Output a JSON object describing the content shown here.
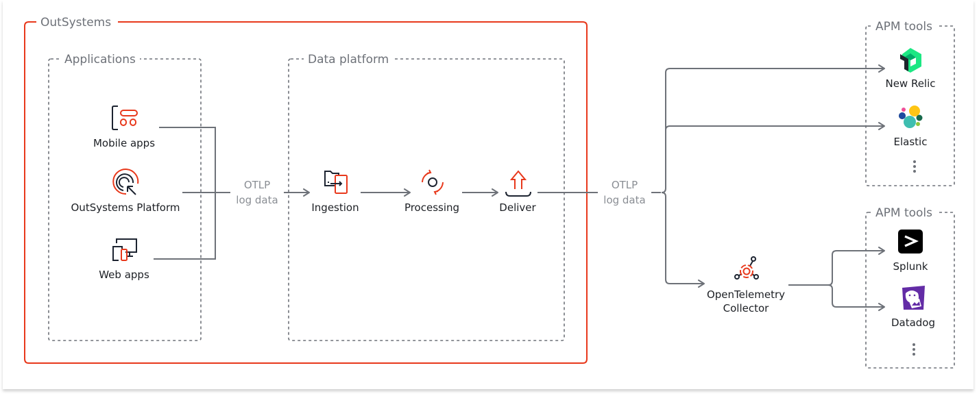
{
  "colors": {
    "brand_red": "#e8381b",
    "line_gray": "#6d7178",
    "dark": "#1c2330",
    "label_gray": "#8a8e94"
  },
  "groups": {
    "outsystems": {
      "title": "OutSystems"
    },
    "applications": {
      "title": "Applications"
    },
    "data_platform": {
      "title": "Data platform"
    },
    "apm_tools_top": {
      "title": "APM tools"
    },
    "apm_tools_bottom": {
      "title": "APM tools"
    }
  },
  "nodes": {
    "mobile_apps": {
      "label": "Mobile apps",
      "icon": "mobile-apps-icon"
    },
    "outsystems_platform": {
      "label": "OutSystems Platform",
      "icon": "outsystems-platform-icon"
    },
    "web_apps": {
      "label": "Web apps",
      "icon": "web-apps-icon"
    },
    "ingestion": {
      "label": "Ingestion",
      "icon": "ingestion-icon"
    },
    "processing": {
      "label": "Processing",
      "icon": "processing-icon"
    },
    "deliver": {
      "label": "Deliver",
      "icon": "deliver-icon"
    },
    "otel_collector": {
      "label_line1": "OpenTelemetry",
      "label_line2": "Collector",
      "icon": "opentelemetry-icon"
    },
    "new_relic": {
      "label": "New Relic",
      "icon": "new-relic-logo-icon"
    },
    "elastic": {
      "label": "Elastic",
      "icon": "elastic-logo-icon"
    },
    "splunk": {
      "label": "Splunk",
      "icon": "splunk-logo-icon"
    },
    "datadog": {
      "label": "Datadog",
      "icon": "datadog-logo-icon"
    }
  },
  "edge_labels": {
    "otlp_in": {
      "line1": "OTLP",
      "line2": "log data"
    },
    "otlp_out": {
      "line1": "OTLP",
      "line2": "log data"
    }
  },
  "more_indicator": "more-icon"
}
